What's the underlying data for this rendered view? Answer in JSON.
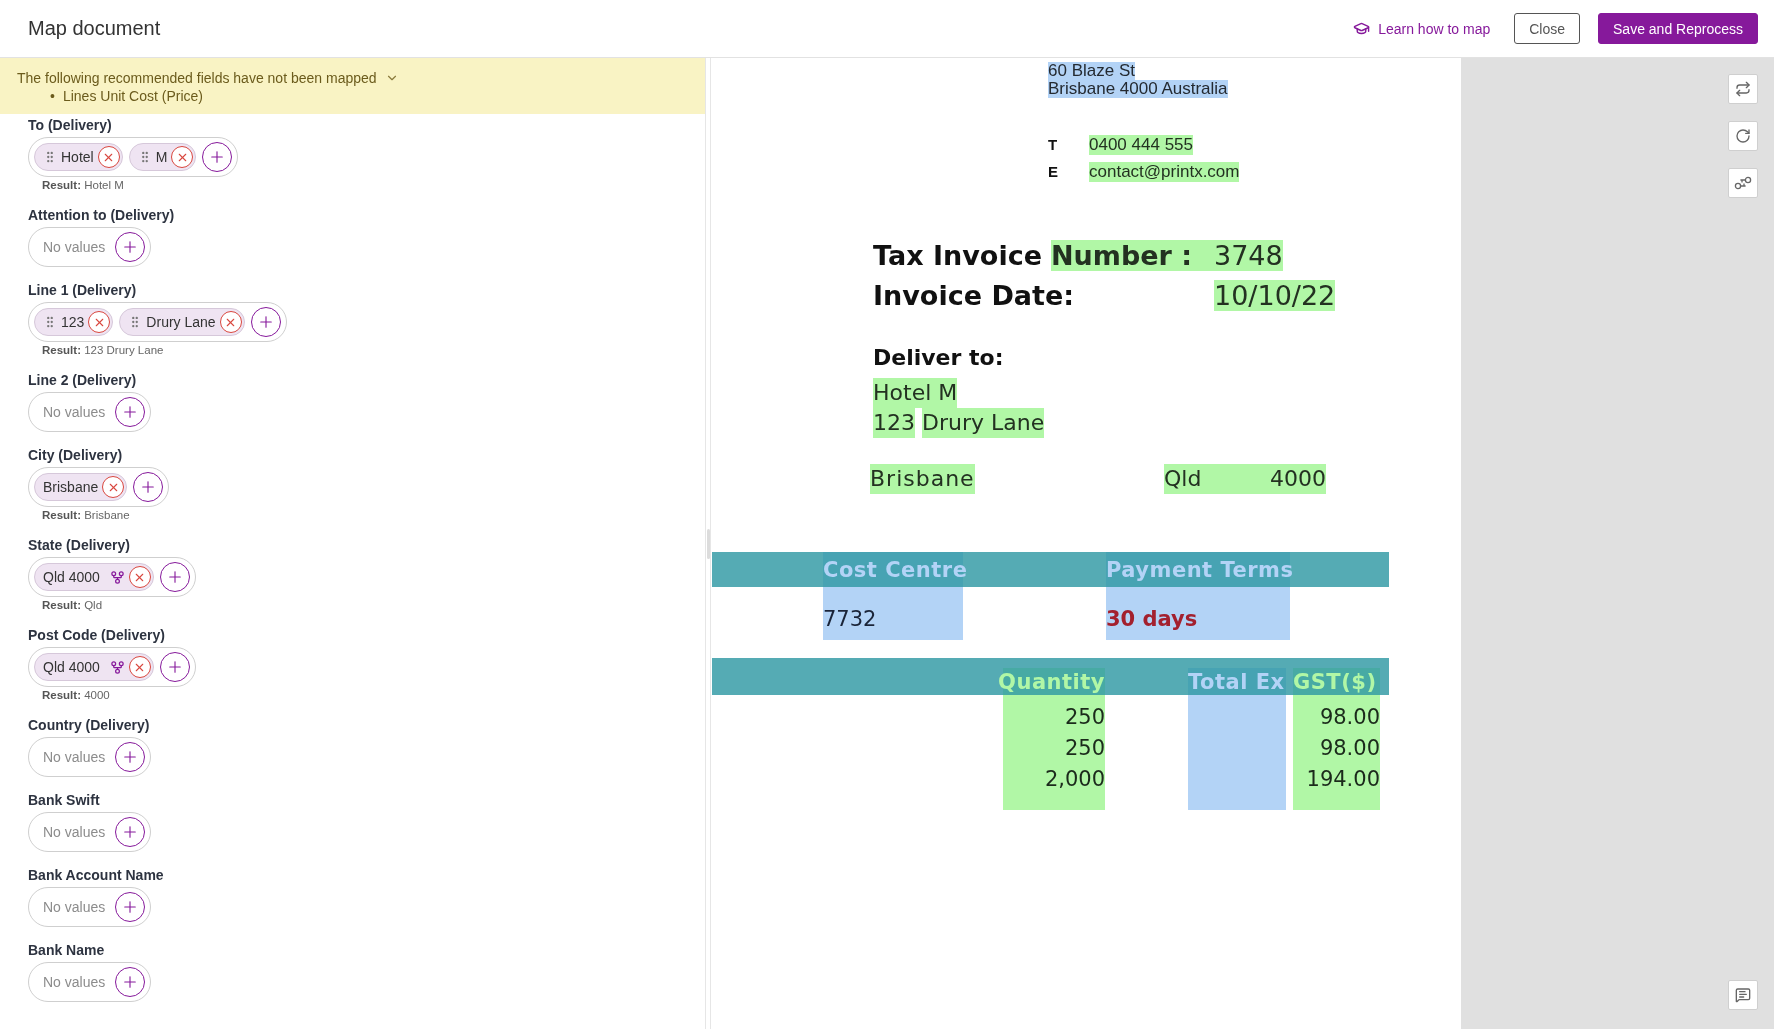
{
  "header": {
    "title": "Map document",
    "help_link": "Learn how to map",
    "buttons": [
      {
        "label": "Close",
        "kind": "secondary"
      },
      {
        "label": "Save and Reprocess",
        "kind": "primary"
      }
    ]
  },
  "banner": {
    "message": "The following recommended fields have not been mapped",
    "expanded": true,
    "items": [
      {
        "marker": "•",
        "text": "Lines Unit Cost (Price)"
      }
    ]
  },
  "fields": [
    {
      "label": "To (Delivery)",
      "tokens": [
        {
          "text": "Hotel",
          "kind": "drag"
        },
        {
          "text": "M",
          "kind": "drag"
        }
      ],
      "result": "**Result:** Hotel M"
    },
    {
      "label": "Attention to (Delivery)",
      "placeholder": "No values"
    },
    {
      "label": "Line 1 (Delivery)",
      "tokens": [
        {
          "text": "123",
          "kind": "drag"
        },
        {
          "text": "Drury Lane",
          "kind": "drag"
        }
      ],
      "result": "**Result:** 123 Drury Lane"
    },
    {
      "label": "Line 2 (Delivery)",
      "placeholder": "No values"
    },
    {
      "label": "City (Delivery)",
      "tokens": [
        {
          "text": "Brisbane",
          "kind": "plain"
        }
      ],
      "result": "**Result:** Brisbane"
    },
    {
      "label": "State (Delivery)",
      "tokens": [
        {
          "text": "Qld 4000",
          "kind": "split"
        }
      ],
      "result": "**Result:** Qld"
    },
    {
      "label": "Post Code (Delivery)",
      "tokens": [
        {
          "text": "Qld 4000",
          "kind": "split"
        }
      ],
      "result": "**Result:** 4000"
    },
    {
      "label": "Country (Delivery)",
      "placeholder": "No values"
    },
    {
      "label": "Bank Swift",
      "placeholder": "No values"
    },
    {
      "label": "Bank Account Name",
      "placeholder": "No values"
    },
    {
      "label": "Bank Name",
      "placeholder": "No values"
    }
  ],
  "document": {
    "address": [
      {
        "text": "60 Blaze St",
        "color": "#b3d3f6"
      },
      {
        "text": "Brisbane 4000 Australia",
        "color": "#b3d3f6"
      }
    ],
    "contacts": [
      {
        "label": "T",
        "value": "0400 444 555",
        "color": "#b1f7a6"
      },
      {
        "label": "E",
        "value": "contact@printx.com",
        "color": "#b1f7a6"
      }
    ],
    "title_rows": [
      {
        "parts": [
          {
            "text": "Tax Invoice"
          },
          {
            "text": "Number :",
            "color": "#b1f7a6"
          }
        ],
        "value": {
          "text": "3748",
          "color": "#b1f7a6"
        }
      },
      {
        "parts": [
          {
            "text": "Invoice Date:"
          }
        ],
        "value": {
          "text": "10/10/22",
          "color": "#b1f7a6"
        }
      }
    ],
    "delivery": {
      "heading": "Deliver to:",
      "lines": [
        [
          {
            "text": "Hotel M",
            "color": "#b1f7a6"
          }
        ],
        [
          {
            "text": "123",
            "color": "#b1f7a6"
          },
          {
            "text": "Drury Lane",
            "color": "#b1f7a6"
          }
        ]
      ]
    },
    "location": [
      {
        "text": "Brisbane",
        "color": "#b1f7a6"
      },
      {
        "text": "Qld",
        "color": "#b1f7a6"
      },
      {
        "text": "4000",
        "color": "#b1f7a6"
      }
    ],
    "info_table": {
      "columns": [
        {
          "label": "Cost Centre",
          "value": "7732",
          "color": "#b3d3f6",
          "kind": "plain"
        },
        {
          "label": "Payment Terms",
          "value": "30 days",
          "color": "#b3d3f6",
          "kind": "alert"
        }
      ]
    },
    "lines_table": {
      "columns": [
        {
          "label": "Quantity",
          "color": "#b1f7a6",
          "values": [
            "250",
            "250",
            "2,000"
          ]
        },
        {
          "label": "Total Ex",
          "color": "#b3d3f6"
        },
        {
          "label": "GST($)",
          "color": "#b1f7a6",
          "values": [
            "98.00",
            "98.00",
            "194.00"
          ]
        }
      ]
    }
  }
}
